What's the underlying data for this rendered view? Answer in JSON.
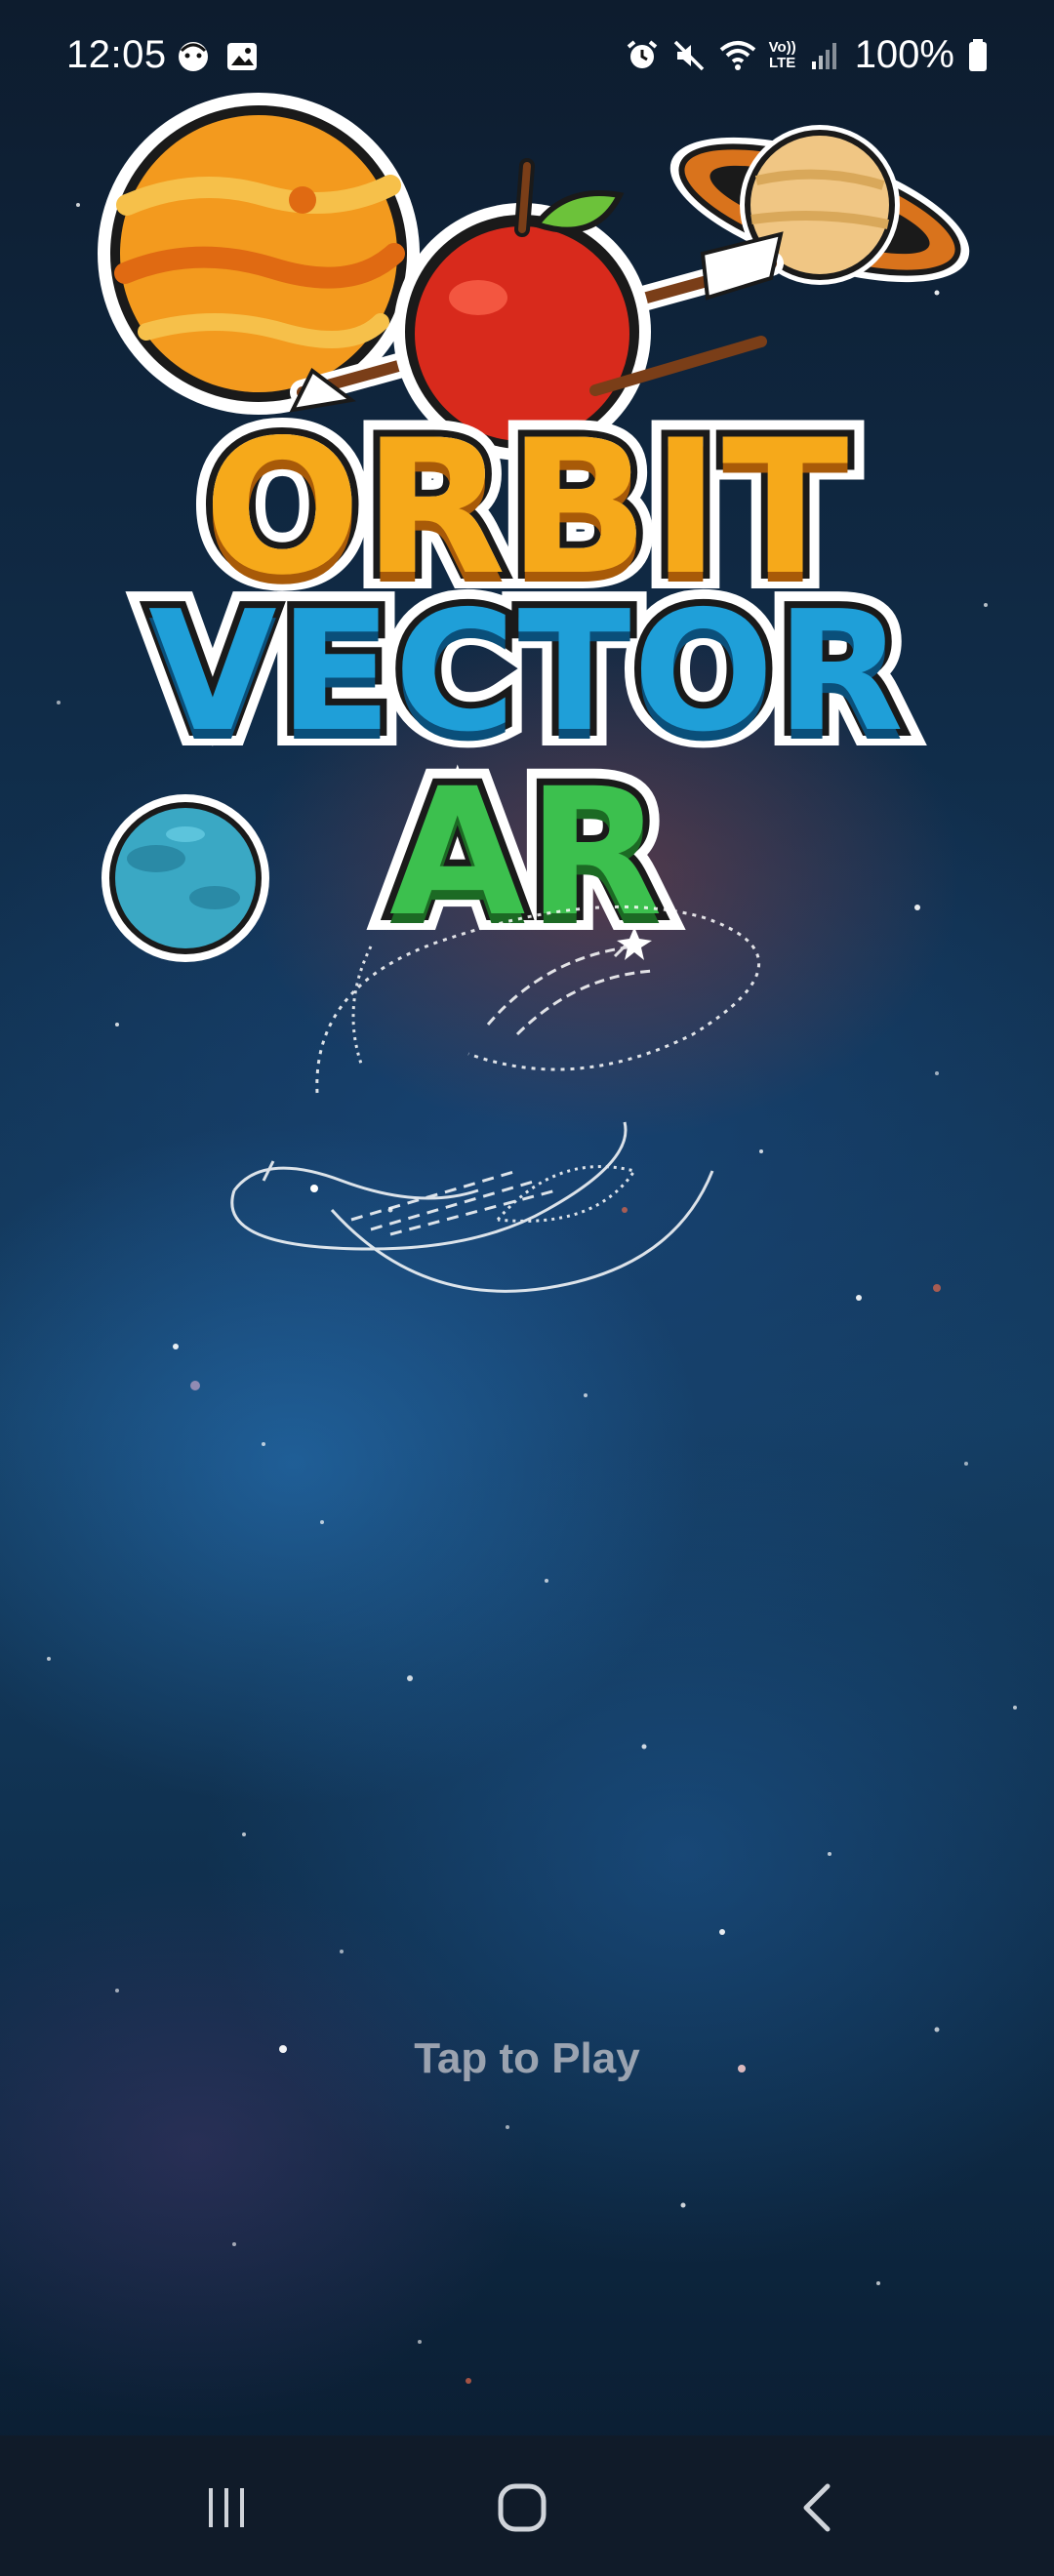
{
  "status_bar": {
    "time": "12:05",
    "left_icons": [
      "face-icon",
      "gallery-icon"
    ],
    "right_icons": [
      "alarm-icon",
      "mute-icon",
      "wifi-icon",
      "volte-icon",
      "signal-icon"
    ],
    "volte_label_top": "Vo))",
    "volte_label_bottom": "LTE",
    "battery_percent": "100%"
  },
  "logo": {
    "line1": "ORBIT",
    "line2": "VECTOR",
    "line3": "AR"
  },
  "main": {
    "tap_to_play": "Tap to Play"
  },
  "nav_bar": {
    "buttons": [
      "recent-apps",
      "home",
      "back"
    ]
  }
}
